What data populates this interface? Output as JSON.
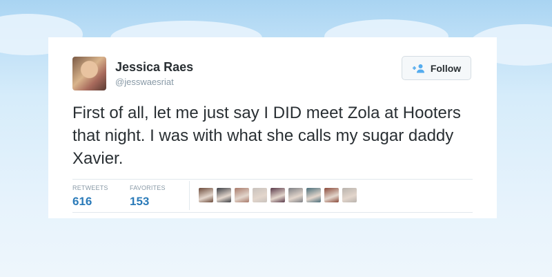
{
  "user": {
    "name": "Jessica Raes",
    "handle": "@jesswaesriat"
  },
  "follow_button": {
    "label": "Follow",
    "icon": "add-person-icon"
  },
  "tweet": {
    "text": "First of all, let me just say I DID meet Zola at Hooters that night. I was with what she calls my sugar daddy Xavier."
  },
  "stats": {
    "retweets_label": "RETWEETS",
    "retweets": "616",
    "favorites_label": "FAVORITES",
    "favorites": "153"
  },
  "favoriters": [
    {
      "color": "#6b4a3a"
    },
    {
      "color": "#3c3f45"
    },
    {
      "color": "#a87a6a"
    },
    {
      "color": "#c9c2bd"
    },
    {
      "color": "#5a3a4a"
    },
    {
      "color": "#7d7f84"
    },
    {
      "color": "#4a6e7a"
    },
    {
      "color": "#8a4a3a"
    },
    {
      "color": "#b9b3ad"
    }
  ],
  "colors": {
    "accent": "#2b7bb9",
    "text": "#292f33",
    "muted": "#8899a6"
  }
}
